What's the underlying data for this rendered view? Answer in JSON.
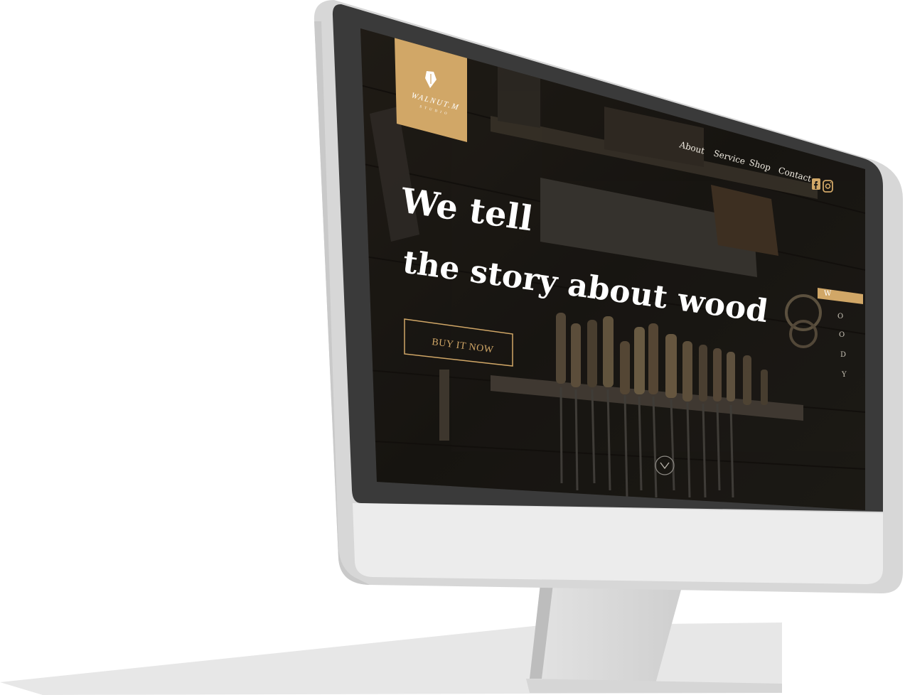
{
  "site": {
    "logo": {
      "brand": "WALNUT.M",
      "tagline": "S T U D I O"
    },
    "nav": {
      "items": [
        {
          "id": "about",
          "label": "About"
        },
        {
          "id": "service",
          "label": "Service"
        },
        {
          "id": "shop",
          "label": "Shop"
        },
        {
          "id": "contact",
          "label": "Contact"
        }
      ]
    },
    "social": {
      "facebook_icon": "facebook-icon",
      "instagram_icon": "instagram-icon"
    },
    "hero": {
      "line1": "We tell",
      "line2": "the story about wood",
      "cta_label": "BUY IT NOW",
      "side_word": [
        "W",
        "O",
        "O",
        "D",
        "Y"
      ]
    },
    "scroll_icon": "chevron-down-circle-icon"
  },
  "colors": {
    "accent": "#d1a767",
    "bezel": "#3a3a3a",
    "chin": "#ececec",
    "hero_overlay": "#1a1916"
  }
}
